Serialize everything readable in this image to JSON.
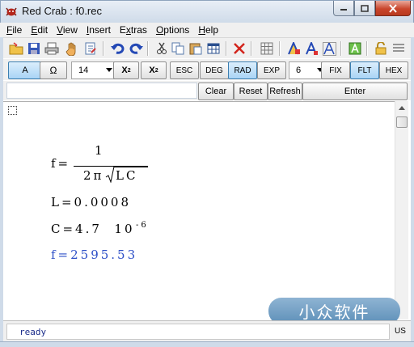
{
  "window": {
    "title": "Red Crab : f0.rec",
    "minimize_icon": "minimize-icon",
    "maximize_icon": "maximize-icon",
    "close_icon": "close-icon",
    "close_color": "#c9462c"
  },
  "menu": [
    {
      "label": "File",
      "key": "F",
      "rest": "ile"
    },
    {
      "label": "Edit",
      "key": "E",
      "rest": "dit"
    },
    {
      "label": "View",
      "key": "V",
      "rest": "iew"
    },
    {
      "label": "Insert",
      "key": "I",
      "rest": "nsert"
    },
    {
      "label": "Extras",
      "key": "x",
      "pre": "E",
      "rest": "tras"
    },
    {
      "label": "Options",
      "key": "O",
      "rest": "ptions"
    },
    {
      "label": "Help",
      "key": "H",
      "rest": "elp"
    }
  ],
  "toolbar": {
    "icons": [
      "open-folder-icon",
      "save-disk-icon",
      "print-icon",
      "hand-icon",
      "edit-page-icon",
      "undo-icon",
      "redo-icon",
      "cut-icon",
      "copy-icon",
      "paste-icon",
      "table-icon",
      "delete-x-icon",
      "grid-icon",
      "font-a-color-icon",
      "font-a-size-icon",
      "font-a-outline-icon",
      "green-a-icon",
      "lock-icon",
      "lines-icon"
    ]
  },
  "mode_toolbar": {
    "a_label": "A",
    "omega_label": "Ω",
    "font_size": "14",
    "square_label": "X",
    "square_sup": "2",
    "sub_label": "X",
    "sub_sub": "2",
    "esc_label": "ESC",
    "deg_label": "DEG",
    "rad_label": "RAD",
    "exp_label": "EXP",
    "digits": "6",
    "fix_label": "FIX",
    "flt_label": "FLT",
    "hex_label": "HEX",
    "active_color": "#a9d4f5"
  },
  "input_row": {
    "value": "",
    "clear_label": "Clear",
    "reset_label": "Reset",
    "refresh_label": "Refresh",
    "enter_label": "Enter"
  },
  "worksheet": {
    "formula_lhs": "f=",
    "formula_numerator": "1",
    "formula_denominator_prefix": "2π",
    "formula_radicand": "LC",
    "line_l": "L=0.0008",
    "line_c_base": "C=4.7  10",
    "line_c_exp": "-6",
    "result": "f=2595.53",
    "result_color": "#2d4fc7"
  },
  "watermark": {
    "text": "小众软件"
  },
  "status": {
    "text": "ready",
    "locale": "US"
  }
}
